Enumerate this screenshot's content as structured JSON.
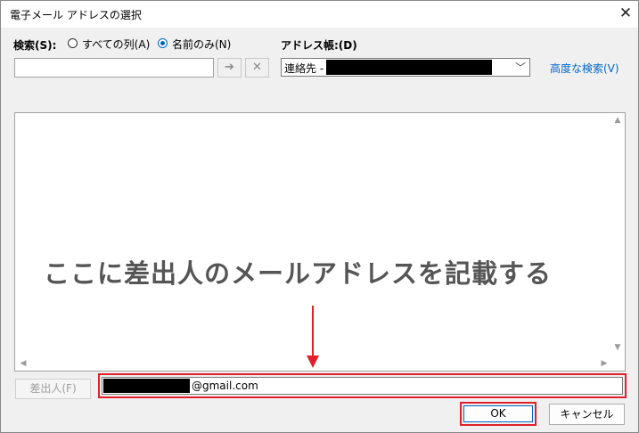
{
  "window": {
    "title": "電子メール アドレスの選択",
    "close_glyph": "✕"
  },
  "search": {
    "label": "検索(S):",
    "radio_all_label": "すべての列(A)",
    "radio_name_label": "名前のみ(N)",
    "selected": "name_only",
    "value": "",
    "go_glyph": "➔",
    "clear_glyph": "✕"
  },
  "address_book": {
    "label": "アドレス帳:(D)",
    "selected_prefix": "連絡先 -",
    "dropdown_glyph": "﹀"
  },
  "advanced_search_link": "高度な検索(V)",
  "list": {
    "scroll_up_glyph": "▲",
    "scroll_down_glyph": "▼",
    "scroll_left_glyph": "◀",
    "scroll_right_glyph": "▶"
  },
  "annotation": {
    "text": "ここに差出人のメールアドレスを記載する",
    "color": "#e0202a"
  },
  "from": {
    "button_label": "差出人(F)",
    "email_suffix": "@gmail.com"
  },
  "buttons": {
    "ok_label": "OK",
    "cancel_label": "キャンセル"
  },
  "colors": {
    "accent": "#0067c0",
    "link": "#0066cc",
    "highlight": "#e0202a",
    "annotation_text": "#555555"
  }
}
